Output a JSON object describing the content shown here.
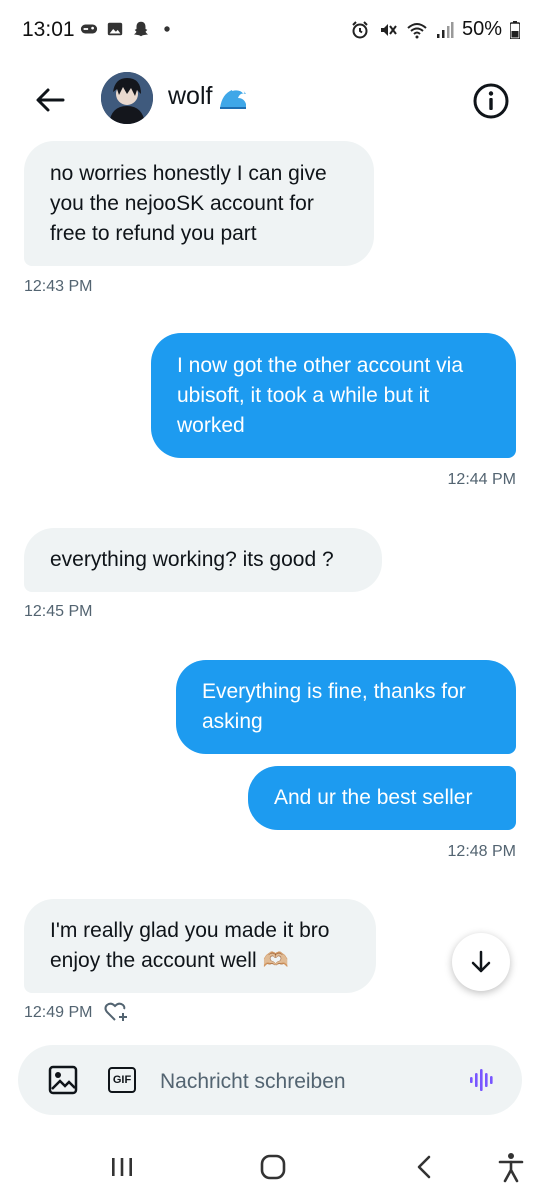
{
  "status_bar": {
    "time": "13:01",
    "battery": "50%"
  },
  "header": {
    "title": "wolf"
  },
  "messages": [
    {
      "direction": "in",
      "text": "no worries honestly I can give you the nejooSK account for free to refund you part"
    },
    {
      "direction": "out",
      "text": "I now got the other account via ubisoft, it took a while but it worked"
    },
    {
      "direction": "in",
      "text": "everything working? its good ?"
    },
    {
      "direction": "out",
      "text": "Everything is fine, thanks for asking"
    },
    {
      "direction": "out",
      "text": "And ur the best seller"
    },
    {
      "direction": "in",
      "text": "I'm really glad you made it bro enjoy the account well 🫶🏼"
    }
  ],
  "timestamps": [
    "12:43 PM",
    "12:44 PM",
    "12:45 PM",
    "12:48 PM",
    "12:49 PM"
  ],
  "composer": {
    "placeholder": "Nachricht schreiben",
    "gif_label": "GIF"
  },
  "colors": {
    "outgoing_bubble": "#1d9bf0",
    "incoming_bubble": "#eff3f4",
    "voice_icon": "#7856ff"
  }
}
